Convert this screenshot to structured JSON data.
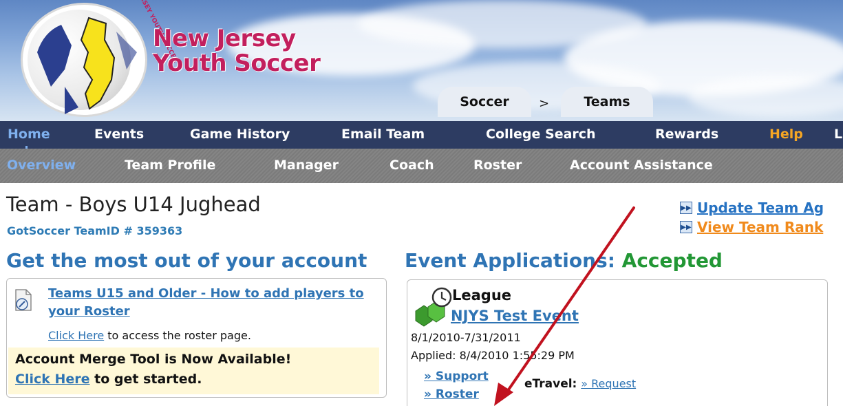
{
  "logo": {
    "line1": "New Jersey",
    "line2": "Youth Soccer",
    "arc_text": "NEW JERSEY YOUTH SOCCER"
  },
  "breadcrumb": {
    "item1": "Soccer",
    "separator": ">",
    "item2": "Teams"
  },
  "nav_primary": [
    {
      "label": "Home",
      "state": "active"
    },
    {
      "label": "Events"
    },
    {
      "label": "Game History"
    },
    {
      "label": "Email Team"
    },
    {
      "label": "College Search"
    },
    {
      "label": "Rewards"
    },
    {
      "label": "Help",
      "state": "highlight"
    },
    {
      "label": "L"
    }
  ],
  "nav_secondary": [
    {
      "label": "Overview",
      "state": "active"
    },
    {
      "label": "Team Profile"
    },
    {
      "label": "Manager"
    },
    {
      "label": "Coach"
    },
    {
      "label": "Roster"
    },
    {
      "label": "Account Assistance"
    }
  ],
  "page": {
    "title": "Team -  Boys U14 Jughead",
    "team_id": "GotSoccer TeamID # 359363"
  },
  "quick_links": [
    {
      "label": "Update Team Ag",
      "color": "#2672c2"
    },
    {
      "label": "View Team Rank",
      "color": "#f08a1c"
    }
  ],
  "account_section": {
    "heading": "Get the most out of your account",
    "tip_link": "Teams U15 and Older - How to add players to your Roster",
    "click_here": "Click Here",
    "click_text": " to access the roster page.",
    "merge_title": "Account Merge Tool is Now Available!",
    "merge_link": "Click Here",
    "merge_text": " to get started."
  },
  "event_section": {
    "heading": "Event Applications: ",
    "status": "Accepted",
    "type": "League",
    "event_name": "NJYS Test Event",
    "dates": "8/1/2010-7/31/2011",
    "applied": "Applied: 8/4/2010 1:55:29 PM",
    "support_link": "» Support",
    "roster_link": "» Roster",
    "etravel_label": "eTravel: ",
    "etravel_link": "» Request"
  },
  "colors": {
    "nav_primary_bg": "#2d3c62",
    "nav_active": "#7fb0ee",
    "help": "#f6a623",
    "heading_blue": "#2f74b4",
    "accepted_green": "#229735",
    "logo_magenta": "#c21f5d",
    "arrow_red": "#c1121f"
  }
}
